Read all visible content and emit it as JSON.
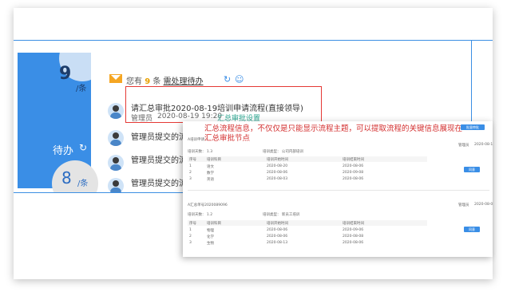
{
  "left_stats": {
    "pending_count": "9",
    "pending_unit": "/条",
    "todo_label": "待办",
    "refresh_icon": "refresh-icon",
    "done_count": "8",
    "done_unit": "/条"
  },
  "message_bar": {
    "prefix": "您有",
    "count": "9",
    "suffix": "条",
    "link": "需处理待办"
  },
  "rows": [
    {
      "title": "请汇总审批2020-08-19培训申请流程(直接领导)",
      "user": "管理员",
      "time": "2020-08-19 19:20",
      "link": "汇总审批设置"
    },
    {
      "title": "管理员提交的流"
    },
    {
      "title": "管理员提交的流"
    },
    {
      "title": "管理员提交的流"
    }
  ],
  "overlay": {
    "callout": "汇总流程信息，不仅仅是只能显示流程主题，可以提取流程的关键信息展现在汇总审批节点",
    "btn_top": "批量审批",
    "sections": [
      {
        "header": "A培训申请...",
        "user": "管理员",
        "date": "2020-08-19",
        "meta": "培训天数：  1.3",
        "meta2": "培训类型：  公司内部培训",
        "cols": [
          "序号",
          "培训科目",
          "培训开始时间",
          "培训结束时间"
        ],
        "rows": [
          [
            "1",
            "语文",
            "2020-08-20",
            "2020-08-06"
          ],
          [
            "2",
            "数学",
            "2020-08-06",
            "2020-09-08"
          ],
          [
            "3",
            "英语",
            "2020-08-03",
            "2020-08-06"
          ]
        ],
        "btn": "同意"
      },
      {
        "header": "A汇总单号2020089096",
        "user": "管理员",
        "date": "2020-08-0",
        "meta": "培训天数：  1.2",
        "meta2": "培训类型：  新员工培训",
        "cols": [
          "序号",
          "培训科目",
          "培训开始时间",
          "培训结束时间"
        ],
        "rows": [
          [
            "1",
            "物理",
            "2020-08-06",
            "2020-09-06"
          ],
          [
            "2",
            "化学",
            "2020-08-06",
            "2020-08-08"
          ],
          [
            "3",
            "生物",
            "2020-08-13",
            "2020-08-06"
          ]
        ],
        "btn": "同意"
      }
    ]
  }
}
